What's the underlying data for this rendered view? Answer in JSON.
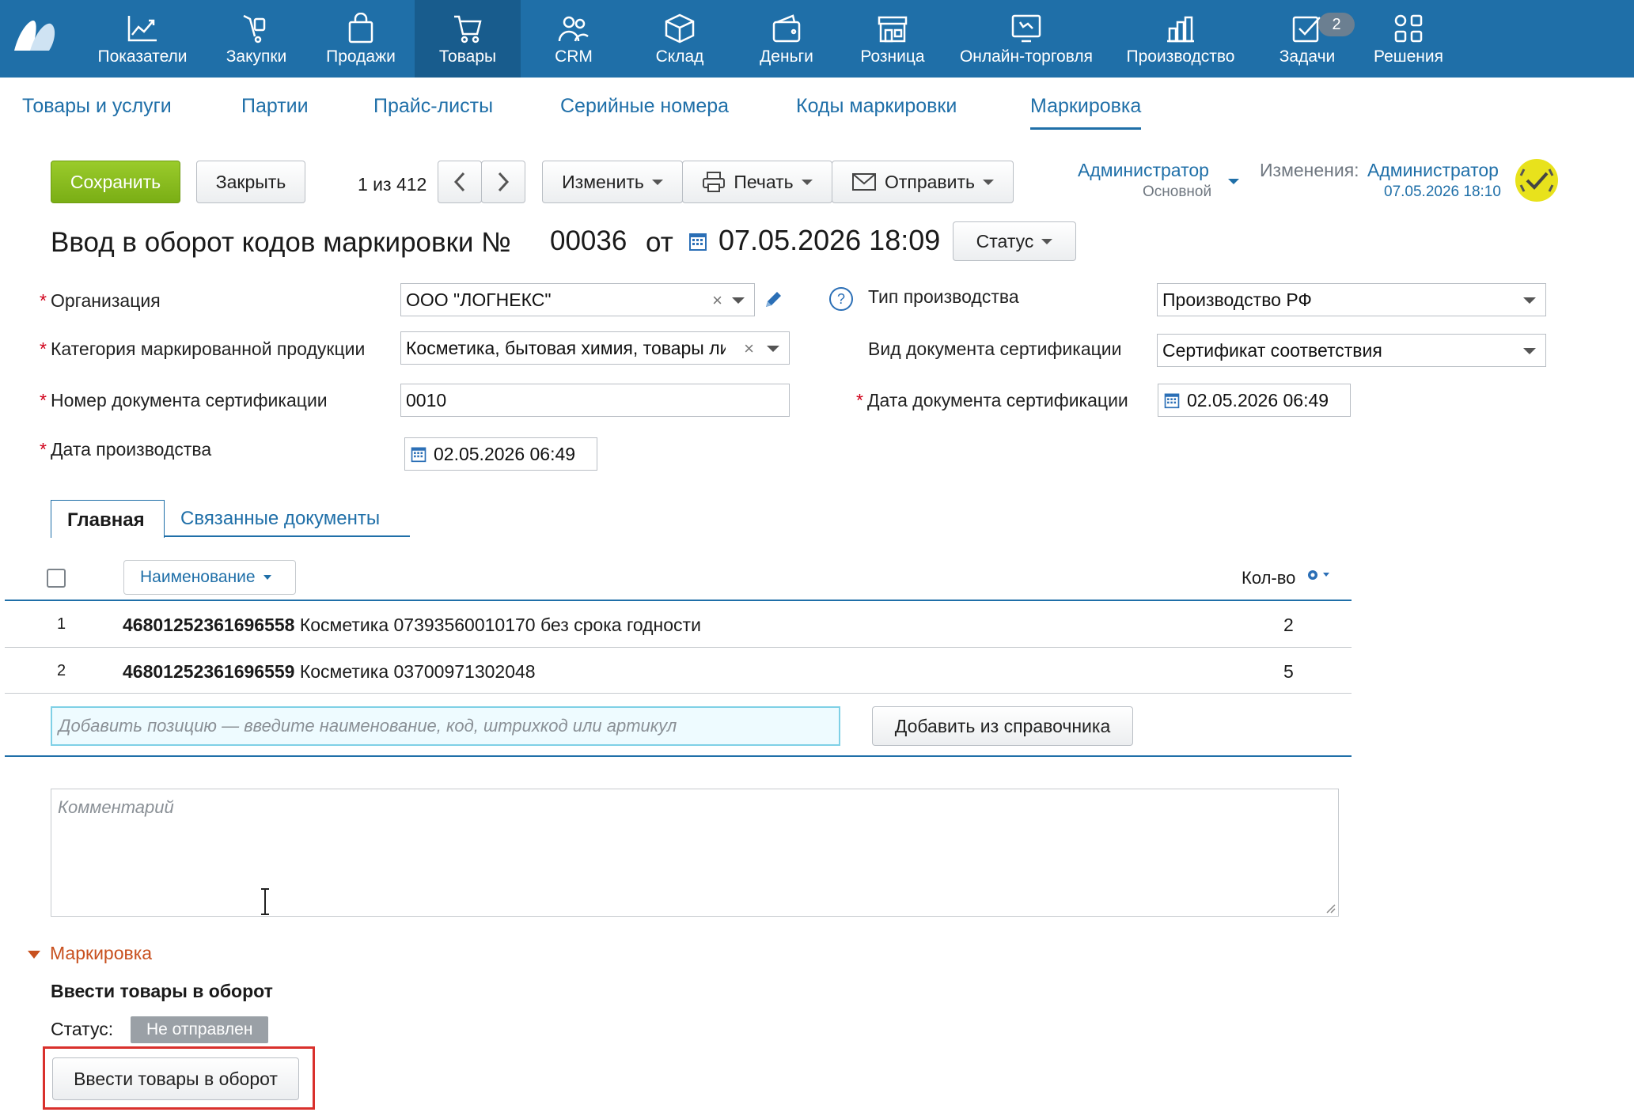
{
  "nav": {
    "items": [
      {
        "label": "Показатели",
        "icon": "chart-icon"
      },
      {
        "label": "Закупки",
        "icon": "cart-hand-icon"
      },
      {
        "label": "Продажи",
        "icon": "bag-icon"
      },
      {
        "label": "Товары",
        "icon": "shopping-cart-icon"
      },
      {
        "label": "CRM",
        "icon": "people-icon"
      },
      {
        "label": "Склад",
        "icon": "box-icon"
      },
      {
        "label": "Деньги",
        "icon": "wallet-icon"
      },
      {
        "label": "Розница",
        "icon": "store-icon"
      },
      {
        "label": "Онлайн-торговля",
        "icon": "online-store-icon"
      },
      {
        "label": "Производство",
        "icon": "factory-icon"
      },
      {
        "label": "Задачи",
        "icon": "tasks-icon"
      },
      {
        "label": "Решения",
        "icon": "apps-icon"
      }
    ],
    "tasks_badge": "2"
  },
  "subtabs": [
    "Товары и услуги",
    "Партии",
    "Прайс-листы",
    "Серийные номера",
    "Коды маркировки",
    "Маркировка"
  ],
  "toolbar": {
    "save": "Сохранить",
    "close": "Закрыть",
    "pager": "1 из 412",
    "edit": "Изменить",
    "print": "Печать",
    "send": "Отправить"
  },
  "user": {
    "name": "Администратор",
    "role": "Основной",
    "changes_label": "Изменения:",
    "changes_user": "Администратор",
    "changes_date": "07.05.2026 18:10"
  },
  "doc": {
    "title": "Ввод в оборот кодов маркировки №",
    "number": "00036",
    "from": "от",
    "date": "07.05.2026 18:09",
    "status_btn": "Статус"
  },
  "form": {
    "org_label": "Организация",
    "org_value": "ООО \"ЛОГНЕКС\"",
    "category_label": "Категория маркированной продукции",
    "category_value": "Косметика, бытовая химия, товары личной гигиены",
    "cert_num_label": "Номер документа сертификации",
    "cert_num_value": "0010",
    "prod_date_label": "Дата производства",
    "prod_date_value": "02.05.2026 06:49",
    "prod_type_label": "Тип производства",
    "prod_type_value": "Производство РФ",
    "cert_kind_label": "Вид документа сертификации",
    "cert_kind_value": "Сертификат соответствия",
    "cert_date_label": "Дата документа сертификации",
    "cert_date_value": "02.05.2026 06:49"
  },
  "tabs": {
    "main": "Главная",
    "related": "Связанные документы"
  },
  "table": {
    "col_name": "Наименование",
    "col_qty": "Кол-во",
    "rows": [
      {
        "n": "1",
        "code": "46801252361696558",
        "name": "Косметика 07393560010170 без срока годности",
        "qty": "2"
      },
      {
        "n": "2",
        "code": "46801252361696559",
        "name": "Косметика 03700971302048",
        "qty": "5"
      }
    ],
    "add_placeholder": "Добавить позицию — введите наименование, код, штрихкод или артикул",
    "add_from_catalog": "Добавить из справочника"
  },
  "comment_placeholder": "Комментарий",
  "marking": {
    "section": "Маркировка",
    "heading": "Ввести товары в оборот",
    "status_label": "Статус:",
    "status_value": "Не отправлен",
    "action": "Ввести товары в оборот"
  },
  "colors": {
    "brand": "#1f6fa8",
    "save": "#8bbd22",
    "highlight": "#d9302c",
    "status_badge": "#9aa0a6"
  }
}
